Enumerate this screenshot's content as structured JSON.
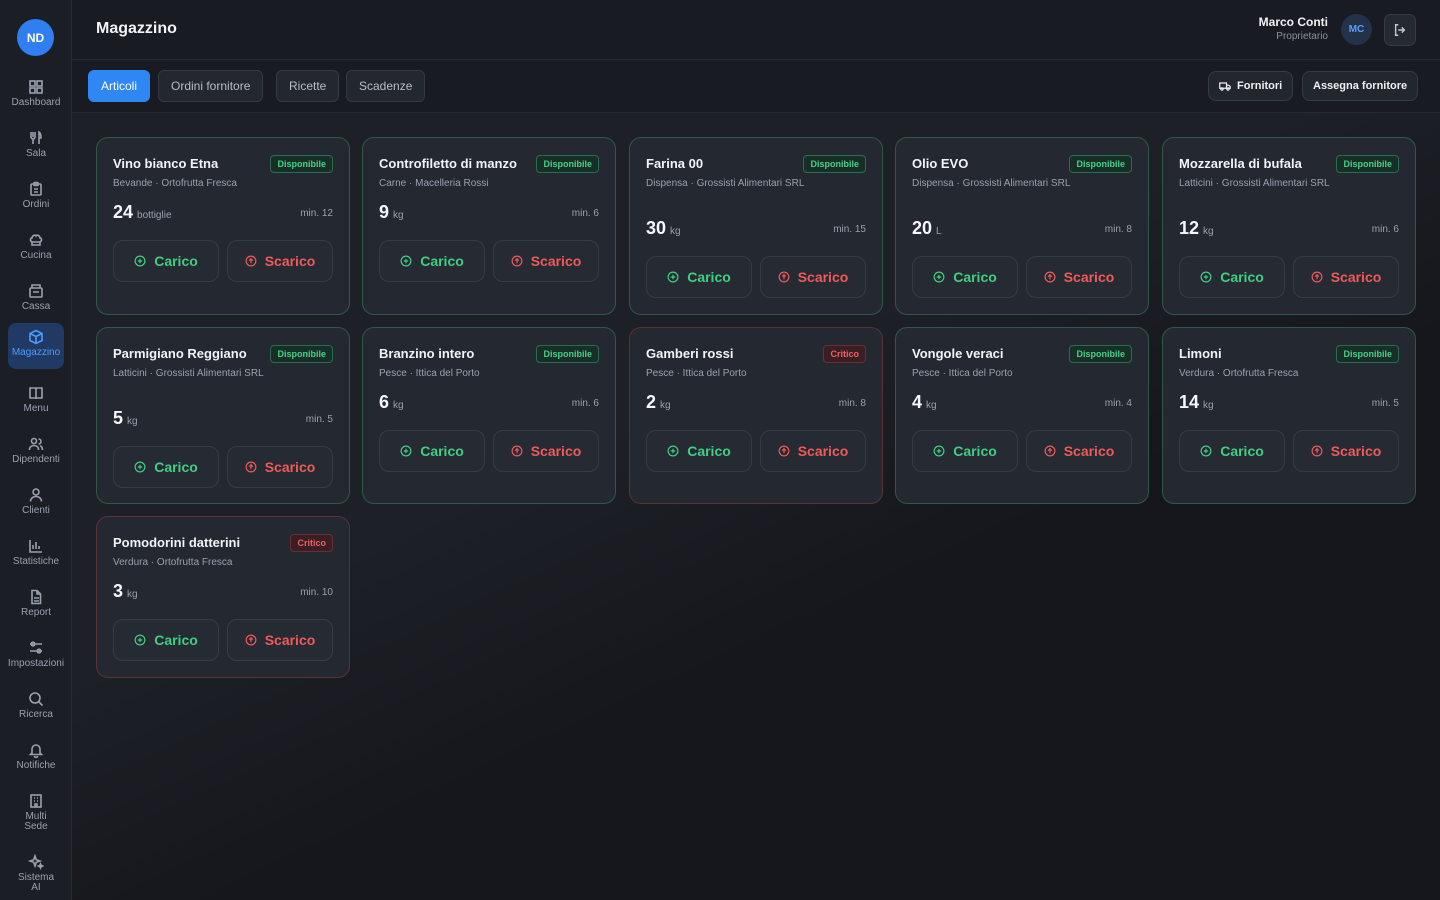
{
  "app": {
    "logo": "ND",
    "title": "Magazzino"
  },
  "sidebar": {
    "items": [
      {
        "label": "Dashboard",
        "icon": "dashboard-icon"
      },
      {
        "label": "Sala",
        "icon": "utensils-icon"
      },
      {
        "label": "Ordini",
        "icon": "clipboard-icon"
      },
      {
        "label": "Cucina",
        "icon": "chef-hat-icon"
      },
      {
        "label": "Cassa",
        "icon": "register-icon"
      },
      {
        "label": "Magazzino",
        "icon": "package-icon"
      },
      {
        "label": "Menu",
        "icon": "book-icon"
      },
      {
        "label": "Dipendenti",
        "icon": "users-icon"
      },
      {
        "label": "Clienti",
        "icon": "user-icon"
      },
      {
        "label": "Statistiche",
        "icon": "bar-chart-icon"
      },
      {
        "label": "Report",
        "icon": "file-icon"
      },
      {
        "label": "Impostazioni",
        "icon": "sliders-icon"
      },
      {
        "label": "Ricerca",
        "icon": "search-icon"
      },
      {
        "label": "Notifiche",
        "icon": "bell-icon"
      },
      {
        "label": "Multi Sede",
        "icon": "building-icon"
      },
      {
        "label": "Sistema AI",
        "icon": "sparkles-icon"
      }
    ],
    "active": "Magazzino"
  },
  "user": {
    "name": "Marco Conti",
    "role": "Proprietario",
    "initials": "MC"
  },
  "tabs": [
    "Articoli",
    "Ordini fornitore",
    "Ricette",
    "Scadenze"
  ],
  "active_tab": "Articoli",
  "actions": {
    "fornitori": "Fornitori",
    "assegna": "Assegna fornitore"
  },
  "labels": {
    "carico": "Carico",
    "scarico": "Scarico"
  },
  "colors": {
    "accent": "#2f86f5",
    "ok": "#3fcf83",
    "danger": "#ef5a5a"
  },
  "items": [
    {
      "name": "Vino bianco Etna",
      "status": "Disponibile",
      "critical": false,
      "sub": "Bevande · Ortofrutta Fresca",
      "qty": "24",
      "unit": "bottiglie",
      "min": "min. 12"
    },
    {
      "name": "Controfiletto di manzo",
      "status": "Disponibile",
      "critical": false,
      "sub": "Carne · Macelleria Rossi",
      "qty": "9",
      "unit": "kg",
      "min": "min. 6"
    },
    {
      "name": "Farina 00",
      "status": "Disponibile",
      "critical": false,
      "sub": "Dispensa · Grossisti Alimentari SRL",
      "qty": "30",
      "unit": "kg",
      "min": "min. 15"
    },
    {
      "name": "Olio EVO",
      "status": "Disponibile",
      "critical": false,
      "sub": "Dispensa · Grossisti Alimentari SRL",
      "qty": "20",
      "unit": "L",
      "min": "min. 8"
    },
    {
      "name": "Mozzarella di bufala",
      "status": "Disponibile",
      "critical": false,
      "sub": "Latticini · Grossisti Alimentari SRL",
      "qty": "12",
      "unit": "kg",
      "min": "min. 6"
    },
    {
      "name": "Parmigiano Reggiano",
      "status": "Disponibile",
      "critical": false,
      "sub": "Latticini · Grossisti Alimentari SRL",
      "qty": "5",
      "unit": "kg",
      "min": "min. 5"
    },
    {
      "name": "Branzino intero",
      "status": "Disponibile",
      "critical": false,
      "sub": "Pesce · Ittica del Porto",
      "qty": "6",
      "unit": "kg",
      "min": "min. 6"
    },
    {
      "name": "Gamberi rossi",
      "status": "Critico",
      "critical": true,
      "sub": "Pesce · Ittica del Porto",
      "qty": "2",
      "unit": "kg",
      "min": "min. 8"
    },
    {
      "name": "Vongole veraci",
      "status": "Disponibile",
      "critical": false,
      "sub": "Pesce · Ittica del Porto",
      "qty": "4",
      "unit": "kg",
      "min": "min. 4"
    },
    {
      "name": "Limoni",
      "status": "Disponibile",
      "critical": false,
      "sub": "Verdura · Ortofrutta Fresca",
      "qty": "14",
      "unit": "kg",
      "min": "min. 5"
    },
    {
      "name": "Pomodorini datterini",
      "status": "Critico",
      "critical": true,
      "sub": "Verdura · Ortofrutta Fresca",
      "qty": "3",
      "unit": "kg",
      "min": "min. 10"
    }
  ]
}
